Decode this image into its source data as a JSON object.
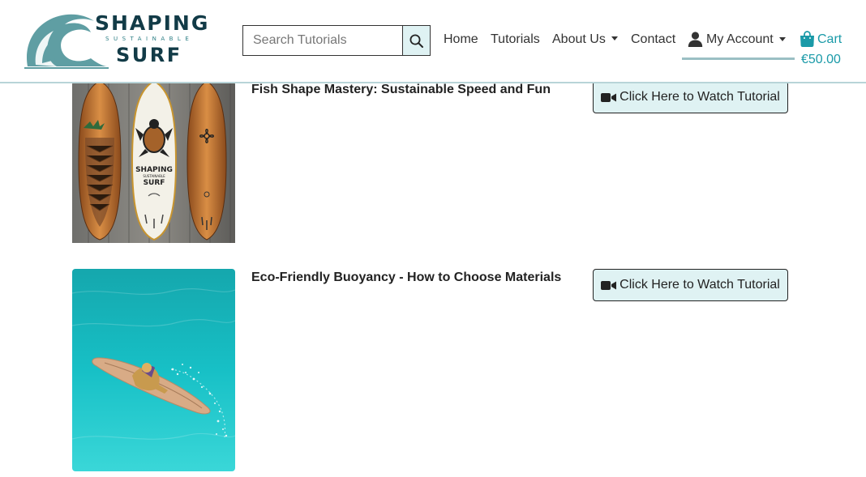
{
  "brand": {
    "line1": "SHAPING",
    "line2": "SUSTAINABLE",
    "line3": "SURF"
  },
  "search": {
    "placeholder": "Search Tutorials",
    "icon": "search-icon"
  },
  "nav": {
    "home": "Home",
    "tutorials": "Tutorials",
    "about": "About Us",
    "contact": "Contact",
    "account": "My Account",
    "account_icon": "user-icon"
  },
  "cart": {
    "label": "Cart",
    "total": "€50.00",
    "icon": "shopping-bag-icon"
  },
  "tutorials": [
    {
      "title": "Fish Shape Mastery: Sustainable Speed and Fun",
      "button_label": "Click Here to Watch Tutorial",
      "board_text": [
        "SHAPING",
        "SUSTAINABLE",
        "SURF"
      ]
    },
    {
      "title": "Eco-Friendly Buoyancy - How to Choose Materials",
      "button_label": "Click Here to Watch Tutorial"
    }
  ],
  "colors": {
    "brand_dark": "#123b47",
    "accent_teal": "#1a9aa8",
    "button_bg": "#dff2f3"
  }
}
